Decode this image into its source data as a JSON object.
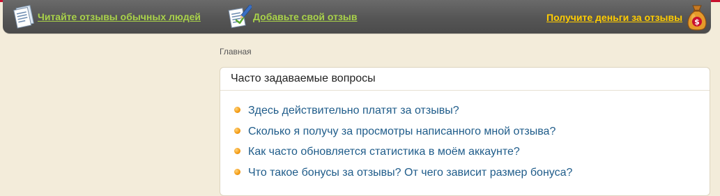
{
  "nav": {
    "read_reviews": {
      "label": "Читайте отзывы обычных людей",
      "icon": "document-icon"
    },
    "add_review": {
      "label": "Добавьте свой отзыв",
      "icon": "edit-document-icon"
    },
    "earn_money": {
      "label": "Получите деньги за отзывы",
      "icon": "money-bag-icon"
    }
  },
  "breadcrumb": {
    "home": "Главная"
  },
  "faq": {
    "title": "Часто задаваемые вопросы",
    "items": [
      "Здесь действительно платят за отзывы?",
      "Сколько я получу за просмотры написанного мной отзыва?",
      "Как часто обновляется статистика в моём аккаунте?",
      "Что такое бонусы за отзывы? От чего зависит размер бонуса?"
    ]
  },
  "colors": {
    "background": "#f3ecda",
    "topbar": "#555555",
    "nav_green": "#a9d24a",
    "nav_yellow": "#ffcc00",
    "link_blue": "#1f5c8a",
    "bullet_orange": "#f39a12",
    "top_accent_red": "#c8102e"
  }
}
